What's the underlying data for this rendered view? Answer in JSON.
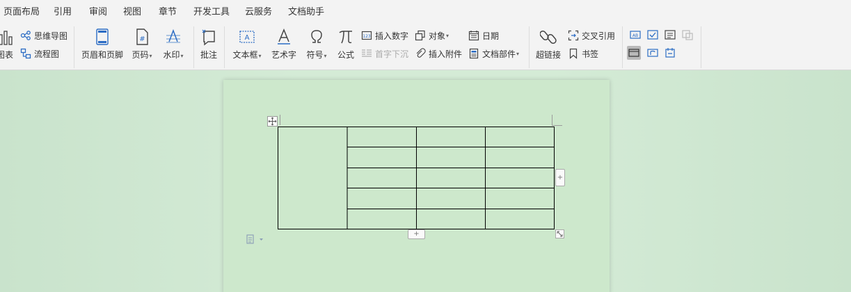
{
  "menu": {
    "items": [
      "页面布局",
      "引用",
      "审阅",
      "视图",
      "章节",
      "开发工具",
      "云服务",
      "文档助手"
    ]
  },
  "toolbar": {
    "chart_label": "图表",
    "mindmap_label": "思维导图",
    "flowchart_label": "流程图",
    "header_footer_label": "页眉和页脚",
    "page_number_label": "页码",
    "watermark_label": "水印",
    "comment_label": "批注",
    "textbox_label": "文本框",
    "wordart_label": "艺术字",
    "symbol_label": "符号",
    "formula_label": "公式",
    "insert_number_label": "插入数字",
    "object_label": "对象",
    "date_label": "日期",
    "dropcap_label": "首字下沉",
    "attachment_label": "插入附件",
    "doc_parts_label": "文档部件",
    "hyperlink_label": "超链接",
    "cross_ref_label": "交叉引用",
    "bookmark_label": "书签",
    "dropdown_caret": "▾"
  },
  "table": {
    "rows": 5,
    "cols": 4,
    "merged_first_column": true,
    "add_button": "+"
  },
  "colors": {
    "accent": "#2b6cc4",
    "page_bg": "#cde8cc",
    "workspace_bg": "#d4ebd6",
    "toolbar_bg": "#f3f3f3"
  }
}
